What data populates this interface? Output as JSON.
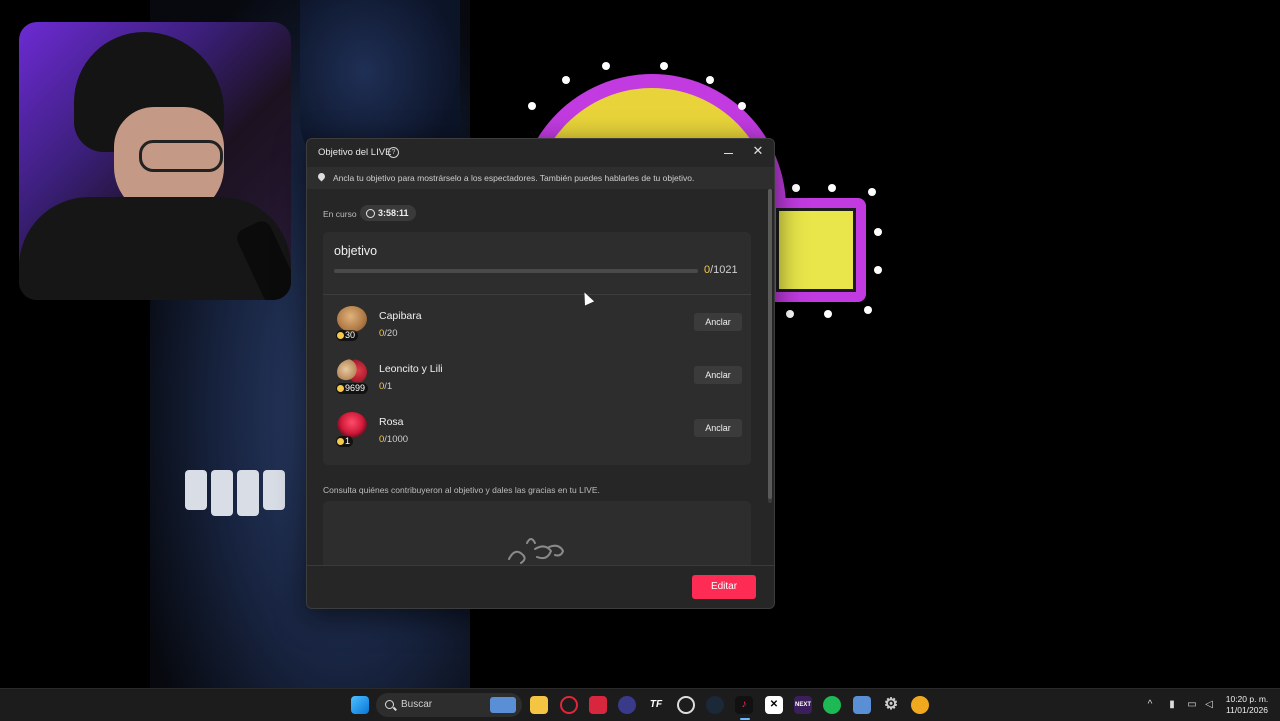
{
  "dialog": {
    "title": "Objetivo del LIVE",
    "info": "Ancla tu objetivo para mostrárselo a los espectadores. También puedes hablarles de tu objetivo.",
    "status_label": "En curso",
    "timer": "3:58:11",
    "goal": {
      "title": "objetivo",
      "current": "0",
      "total": "/1021",
      "progress_fraction": 0
    },
    "gifts": [
      {
        "name": "Capibara",
        "coins": "30",
        "current": "0",
        "total": "/20",
        "pin_label": "Anclar"
      },
      {
        "name": "Leoncito y Lili",
        "coins": "9699",
        "current": "0",
        "total": "/1",
        "pin_label": "Anclar"
      },
      {
        "name": "Rosa",
        "coins": "1",
        "current": "0",
        "total": "/1000",
        "pin_label": "Anclar"
      }
    ],
    "contributors_text": "Consulta quiénes contribuyeron al objetivo y dales las gracias en tu LIVE.",
    "edit_label": "Editar"
  },
  "taskbar": {
    "search_placeholder": "Buscar",
    "time": "10:20 p. m.",
    "date": "11/01/2026",
    "icons": [
      "start-icon",
      "file-explorer-icon",
      "opera-gx-icon",
      "app-red-icon",
      "app-blue-icon",
      "tf-icon",
      "app-badge-icon",
      "steam-icon",
      "tiktok-live-icon",
      "capcut-icon",
      "next-icon",
      "spotify-icon",
      "app-settings-blue-icon",
      "settings-gear-icon",
      "app-yellow-icon"
    ]
  },
  "colors": {
    "accent": "#fe2c55",
    "coin": "#f7c948",
    "dialog_bg": "#262626"
  }
}
